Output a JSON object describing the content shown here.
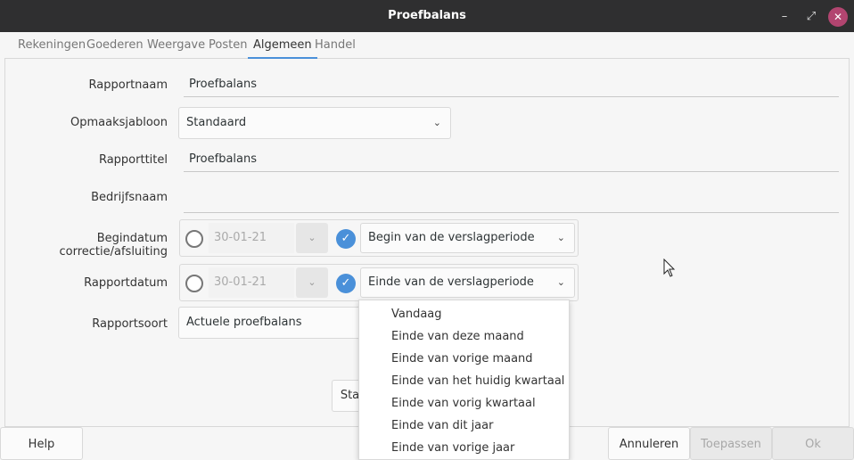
{
  "window": {
    "title": "Proefbalans",
    "min": "–",
    "max": "⤢",
    "close": "✕"
  },
  "tabs": [
    "Rekeningen",
    "Goederen",
    "Weergave",
    "Posten",
    "Algemeen",
    "Handel"
  ],
  "form": {
    "rapportnaam": {
      "label": "Rapportnaam",
      "value": "Proefbalans"
    },
    "opmaak": {
      "label": "Opmaaksjabloon",
      "value": "Standaard"
    },
    "rapporttitel": {
      "label": "Rapporttitel",
      "value": "Proefbalans"
    },
    "bedrijfsnaam": {
      "label": "Bedrijfsnaam",
      "value": ""
    },
    "begindatum": {
      "label": "Begindatum correctie/afsluiting",
      "date": "30-01-21",
      "relative": "Begin van de verslagperiode"
    },
    "rapportdatum": {
      "label": "Rapportdatum",
      "date": "30-01-21",
      "relative": "Einde van de verslagperiode"
    },
    "rapportsoort": {
      "label": "Rapportsoort",
      "value": "Actuele proefbalans"
    },
    "start_button_partial": "Sta"
  },
  "dropdown": {
    "items": [
      "Vandaag",
      "Einde van deze maand",
      "Einde van vorige maand",
      "Einde van het huidig kwartaal",
      "Einde van vorig kwartaal",
      "Einde van dit jaar",
      "Einde van vorige jaar"
    ]
  },
  "buttons": {
    "help": "Help",
    "cancel": "Annuleren",
    "apply": "Toepassen",
    "ok": "Ok"
  },
  "icons": {
    "chevron": "chevron-down-icon",
    "check": "check-icon",
    "radio": "radio-icon"
  },
  "colors": {
    "accent": "#4a90d9",
    "titlebar": "#2f2f30",
    "close": "#b24570"
  }
}
